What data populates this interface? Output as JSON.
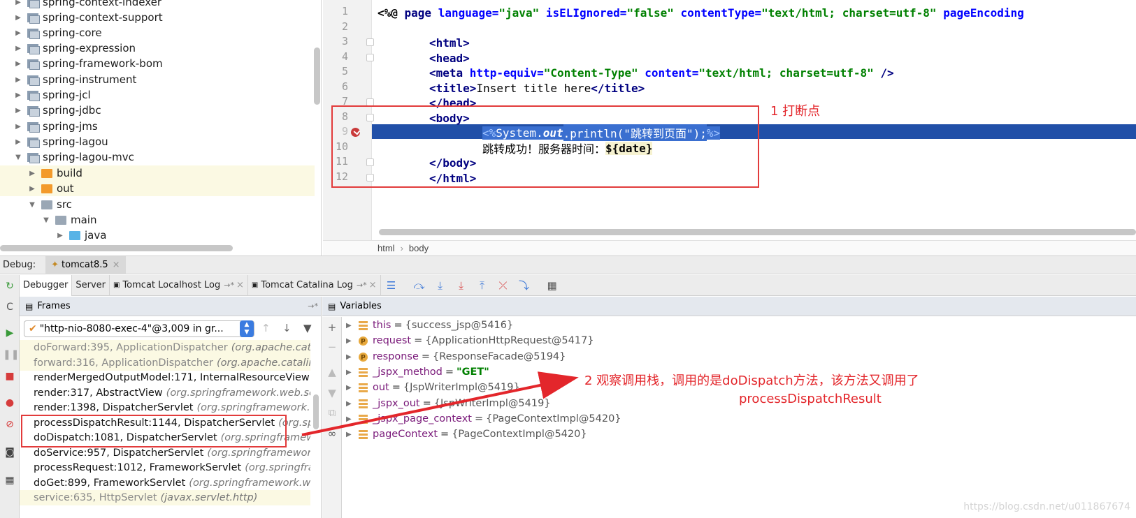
{
  "project_tree": {
    "items": [
      {
        "label": "spring-context-indexer",
        "icon": "library-icon",
        "arrow": "▶"
      },
      {
        "label": "spring-context-support",
        "icon": "library-icon",
        "arrow": "▶"
      },
      {
        "label": "spring-core",
        "icon": "library-icon",
        "arrow": "▶"
      },
      {
        "label": "spring-expression",
        "icon": "library-icon",
        "arrow": "▶"
      },
      {
        "label": "spring-framework-bom",
        "icon": "library-icon",
        "arrow": "▶"
      },
      {
        "label": "spring-instrument",
        "icon": "library-icon",
        "arrow": "▶"
      },
      {
        "label": "spring-jcl",
        "icon": "library-icon",
        "arrow": "▶"
      },
      {
        "label": "spring-jdbc",
        "icon": "library-icon",
        "arrow": "▶"
      },
      {
        "label": "spring-jms",
        "icon": "library-icon",
        "arrow": "▶"
      },
      {
        "label": "spring-lagou",
        "icon": "library-icon",
        "arrow": "▶"
      },
      {
        "label": "spring-lagou-mvc",
        "icon": "library-icon",
        "arrow": "▼"
      },
      {
        "label": "build",
        "icon": "folder-orange-icon",
        "arrow": "▶"
      },
      {
        "label": "out",
        "icon": "folder-orange-icon",
        "arrow": "▶"
      },
      {
        "label": "src",
        "icon": "folder-gray-icon",
        "arrow": "▼"
      },
      {
        "label": "main",
        "icon": "folder-gray-icon",
        "arrow": "▼"
      },
      {
        "label": "java",
        "icon": "folder-blue-icon",
        "arrow": "▶"
      }
    ]
  },
  "editor": {
    "line_numbers": [
      "1",
      "2",
      "3",
      "4",
      "5",
      "6",
      "7",
      "8",
      "9",
      "10",
      "11",
      "12"
    ],
    "breadcrumb": [
      "html",
      "body"
    ],
    "code": {
      "l1": {
        "open": "<%@ ",
        "kw": "page ",
        "a1": "language=",
        "v1": "\"java\" ",
        "a2": "isELIgnored=",
        "v2": "\"false\" ",
        "a3": "contentType=",
        "v3": "\"text/html; charset=utf-8\" ",
        "a4": "pageEncoding"
      },
      "l3": "<html>",
      "l4": "<head>",
      "l5": {
        "tag": "<meta ",
        "a1": "http-equiv=",
        "v1": "\"Content-Type\" ",
        "a2": "content=",
        "v2": "\"text/html; charset=utf-8\"",
        "close": " />"
      },
      "l6": {
        "t1": "<title>",
        "text": "Insert title here",
        "t2": "</title>"
      },
      "l7": "</head>",
      "l8": "<body>",
      "l9": {
        "open": "<%",
        "pre": "System.",
        "italic": "out",
        "post": ".println(\"跳转到页面\");",
        "close": "%>"
      },
      "l10": {
        "text": "跳转成功！服务器时间：",
        "el": "${date}"
      },
      "l11": "</body>",
      "l12": "</html>"
    }
  },
  "annotations": {
    "a1": "1 打断点",
    "a2_line1": "2 观察调用栈，调用的是doDispatch方法，该方法又调用了",
    "a2_line2": "processDispatchResult",
    "colors": {
      "annotation": "#e23b3b"
    }
  },
  "debug": {
    "label": "Debug:",
    "session": "tomcat8.5",
    "tabs": [
      "Debugger",
      "Server",
      "Tomcat Localhost Log",
      "Tomcat Catalina Log"
    ],
    "frames_title": "Frames",
    "variables_title": "Variables",
    "thread": "\"http-nio-8080-exec-4\"@3,009 in gr...",
    "frames": [
      {
        "method": "doForward:395, ApplicationDispatcher",
        "pkg": "(org.apache.catal",
        "lib": true
      },
      {
        "method": "forward:316, ApplicationDispatcher",
        "pkg": "(org.apache.catalina",
        "lib": true
      },
      {
        "method": "renderMergedOutputModel:171, InternalResourceView",
        "pkg": "(c",
        "lib": false
      },
      {
        "method": "render:317, AbstractView",
        "pkg": "(org.springframework.web.se",
        "lib": false
      },
      {
        "method": "render:1398, DispatcherServlet",
        "pkg": "(org.springframework.we",
        "lib": false
      },
      {
        "method": "processDispatchResult:1144, DispatcherServlet",
        "pkg": "(org.spri",
        "lib": false
      },
      {
        "method": "doDispatch:1081, DispatcherServlet",
        "pkg": "(org.springframewo",
        "lib": false
      },
      {
        "method": "doService:957, DispatcherServlet",
        "pkg": "(org.springframework.v",
        "lib": false
      },
      {
        "method": "processRequest:1012, FrameworkServlet",
        "pkg": "(org.springfram",
        "lib": false
      },
      {
        "method": "doGet:899, FrameworkServlet",
        "pkg": "(org.springframework.web",
        "lib": false
      },
      {
        "method": "service:635, HttpServlet",
        "pkg": "(javax.servlet.http)",
        "lib": true
      }
    ],
    "variables": [
      {
        "name": "this",
        "value": "{success_jsp@5416}",
        "icon": "field-icon",
        "str": false
      },
      {
        "name": "request",
        "value": "{ApplicationHttpRequest@5417}",
        "icon": "param-icon",
        "str": false
      },
      {
        "name": "response",
        "value": "{ResponseFacade@5194}",
        "icon": "param-icon",
        "str": false
      },
      {
        "name": "_jspx_method",
        "value": "\"GET\"",
        "icon": "field-icon",
        "str": true
      },
      {
        "name": "out",
        "value": "{JspWriterImpl@5419}",
        "icon": "field-icon",
        "str": false
      },
      {
        "name": "_jspx_out",
        "value": "{JspWriterImpl@5419}",
        "icon": "field-icon",
        "str": false
      },
      {
        "name": "_jspx_page_context",
        "value": "{PageContextImpl@5420}",
        "icon": "field-icon",
        "str": false
      },
      {
        "name": "pageContext",
        "value": "{PageContextImpl@5420}",
        "icon": "field-icon",
        "str": false
      }
    ]
  },
  "watermark": "https://blog.csdn.net/u011867674"
}
